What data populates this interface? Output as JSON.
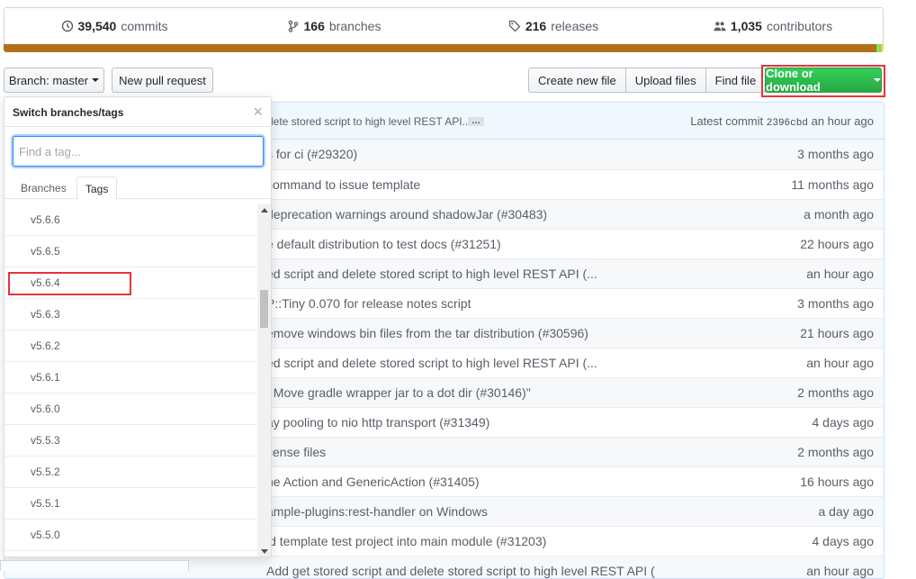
{
  "summary": {
    "commits": {
      "num": "39,540",
      "label": "commits",
      "icon": "history-icon"
    },
    "branches": {
      "num": "166",
      "label": "branches",
      "icon": "git-branch-icon"
    },
    "releases": {
      "num": "216",
      "label": "releases",
      "icon": "tag-icon"
    },
    "contributors": {
      "num": "1,035",
      "label": "contributors",
      "icon": "people-icon"
    }
  },
  "language_bar": {
    "colors": [
      "#b07219",
      "#89e051",
      "#f1e05a"
    ],
    "fractions": [
      0.992,
      0.006,
      0.002
    ]
  },
  "toolbar": {
    "branch_label": "Branch: master",
    "new_pr": "New pull request",
    "create_file": "Create new file",
    "upload_files": "Upload files",
    "find_file": "Find file",
    "clone": "Clone or download"
  },
  "latest_commit": {
    "message": "lete stored script to high level REST API...",
    "ellipsis": "…",
    "prefix": "Latest commit",
    "sha": "2396cbd",
    "age": "an hour ago"
  },
  "commits": [
    {
      "message": "s for ci (#29320)",
      "age": "3 months ago"
    },
    {
      "message": "command to issue template",
      "age": "11 months ago"
    },
    {
      "message": "deprecation warnings around shadowJar (#30483)",
      "age": "a month ago"
    },
    {
      "message": "e default distribution to test docs (#31251)",
      "age": "22 hours ago"
    },
    {
      "message": "ed script and delete stored script to high level REST API (...",
      "age": "an hour ago"
    },
    {
      "message": "P::Tiny 0.070 for release notes script",
      "age": "3 months ago"
    },
    {
      "message": "emove windows bin files from the tar distribution (#30596)",
      "age": "21 hours ago"
    },
    {
      "message": "ed script and delete stored script to high level REST API (...",
      "age": "an hour ago"
    },
    {
      "message": ": Move gradle wrapper jar to a dot dir (#30146)\"",
      "age": "2 months ago"
    },
    {
      "message": "ay pooling to nio http transport (#31349)",
      "age": "4 days ago"
    },
    {
      "message": "cense files",
      "age": "2 months ago"
    },
    {
      "message": "ne Action and GenericAction (#31405)",
      "age": "16 hours ago"
    },
    {
      "message": "ample-plugins:rest-handler on Windows",
      "age": "a day ago"
    },
    {
      "message": "ld template test project into main module (#31203)",
      "age": "4 days ago"
    },
    {
      "message": "Add get stored script and delete stored script to high level REST API (",
      "age": "an hour ago"
    }
  ],
  "dropdown": {
    "title": "Switch branches/tags",
    "close": "×",
    "filter_placeholder": "Find a tag...",
    "tab_branches": "Branches",
    "tab_tags": "Tags",
    "tags": [
      "v5.6.6",
      "v5.6.5",
      "v5.6.4",
      "v5.6.3",
      "v5.6.2",
      "v5.6.1",
      "v5.6.0",
      "v5.5.3",
      "v5.5.2",
      "v5.5.1",
      "v5.5.0"
    ]
  }
}
